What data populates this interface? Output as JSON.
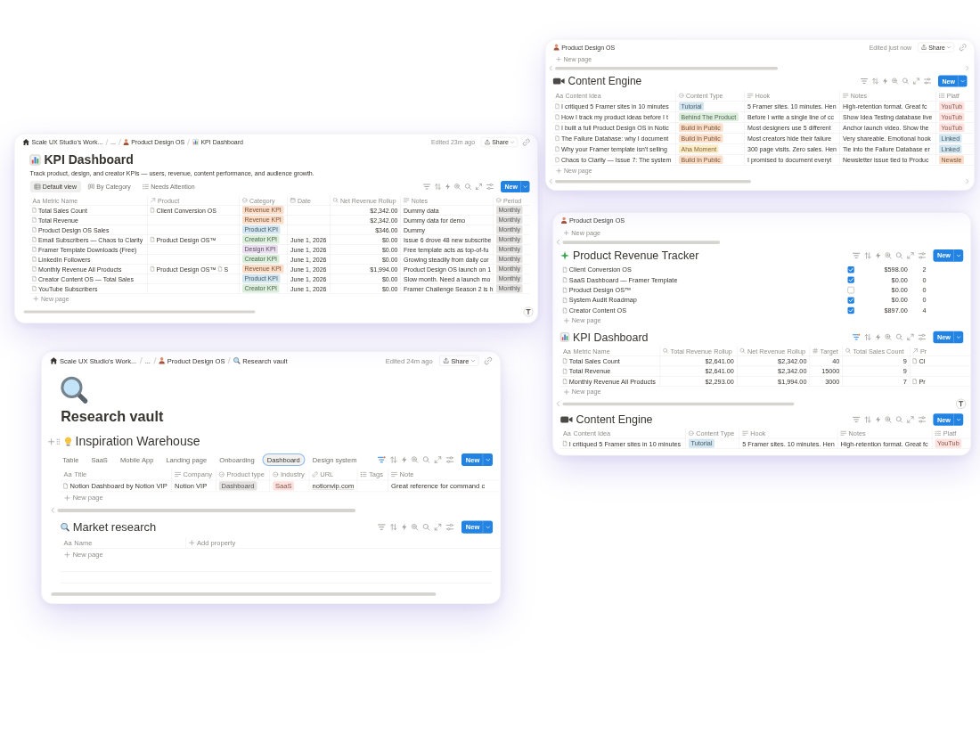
{
  "kpi_dashboard_window": {
    "breadcrumbs": [
      {
        "label": "Scale UX Studio's Work...",
        "kind": "workspace"
      },
      {
        "label": "...",
        "kind": "collapsed"
      },
      {
        "label": "Product Design OS",
        "kind": "teamspace"
      },
      {
        "label": "KPI Dashboard",
        "kind": "page"
      }
    ],
    "edited": "Edited 23m ago",
    "share": "Share",
    "title": "KPI Dashboard",
    "description": "Track product, design, and creator KPIs — users, revenue, content performance, and audience growth.",
    "views": [
      {
        "label": "Default view",
        "kind": "table",
        "selected": true
      },
      {
        "label": "By Category",
        "kind": "board",
        "selected": false
      },
      {
        "label": "Needs Attention",
        "kind": "list",
        "selected": false
      }
    ],
    "toolbar": {
      "filter_active": false,
      "new_button": "New"
    },
    "table": {
      "columns": [
        {
          "glyph": "Aa",
          "label": "Metric Name",
          "kind": "title"
        },
        {
          "label": "Product",
          "kind": "relation"
        },
        {
          "label": "Category",
          "kind": "select"
        },
        {
          "label": "Date",
          "kind": "date"
        },
        {
          "label": "Net Revenue Rollup",
          "kind": "rollup"
        },
        {
          "label": "Notes",
          "kind": "text"
        },
        {
          "label": "Period",
          "kind": "select"
        }
      ],
      "rows": [
        [
          "Total Sales Count",
          [
            "Client Conversion OS"
          ],
          {
            "label": "Revenue KPI",
            "color": "#fadec9"
          },
          null,
          "$2,342.00",
          "Dummy data",
          {
            "label": "Monthly",
            "color": "#e3e2e0"
          }
        ],
        [
          "Total Revenue",
          null,
          {
            "label": "Revenue KPI",
            "color": "#fadec9"
          },
          null,
          "$2,342.00",
          "Dummy data for demo",
          {
            "label": "Monthly",
            "color": "#e3e2e0"
          }
        ],
        [
          "Product Design OS Sales",
          null,
          {
            "label": "Product KPI",
            "color": "#d3e5ef"
          },
          null,
          "$346.00",
          "Dummy",
          {
            "label": "Monthly",
            "color": "#e3e2e0"
          }
        ],
        [
          "Email Subscribers — Chaos to Clarity",
          [
            "Product Design OS™"
          ],
          {
            "label": "Creator KPI",
            "color": "#dbeddb"
          },
          "June 1, 2026",
          "$0.00",
          "Issue 6 drove 48 new subscribe",
          {
            "label": "Monthly",
            "color": "#e3e2e0"
          }
        ],
        [
          "Framer Template Downloads (Free)",
          null,
          {
            "label": "Design KPI",
            "color": "#e8deee"
          },
          "June 1, 2026",
          "$0.00",
          "Free template acts as top-of-fu",
          {
            "label": "Monthly",
            "color": "#e3e2e0"
          }
        ],
        [
          "LinkedIn Followers",
          null,
          {
            "label": "Creator KPI",
            "color": "#dbeddb"
          },
          "June 1, 2026",
          "$0.00",
          "Growing steadily from daily cor",
          {
            "label": "Monthly",
            "color": "#e3e2e0"
          }
        ],
        [
          "Monthly Revenue All Products",
          [
            "Product Design OS™",
            "S"
          ],
          {
            "label": "Revenue KPI",
            "color": "#fadec9"
          },
          "June 1, 2026",
          "$1,994.00",
          "Product Design OS launch on 1",
          {
            "label": "Monthly",
            "color": "#e3e2e0"
          }
        ],
        [
          "Creator Content OS — Total Sales",
          null,
          {
            "label": "Product KPI",
            "color": "#d3e5ef"
          },
          "June 1, 2026",
          "$0.00",
          "Slow month. Need a launch mo",
          {
            "label": "Monthly",
            "color": "#e3e2e0"
          }
        ],
        [
          "YouTube Subscribers",
          null,
          {
            "label": "Creator KPI",
            "color": "#dbeddb"
          },
          "June 1, 2026",
          "$0.00",
          "Framer Challenge Season 2 is h",
          {
            "label": "Monthly",
            "color": "#e3e2e0"
          }
        ]
      ],
      "new_row": "New page"
    }
  },
  "content_engine_window": {
    "breadcrumbs": [
      {
        "label": "Product Design OS",
        "kind": "teamspace"
      }
    ],
    "edited": "Edited just now",
    "share": "Share",
    "new_page_above": "New page",
    "database": {
      "title": "Content Engine",
      "toolbar": {
        "filter_active": false,
        "new_button": "New"
      },
      "table": {
        "columns": [
          {
            "glyph": "Aa",
            "label": "Content Idea",
            "kind": "title"
          },
          {
            "label": "Content Type",
            "kind": "select"
          },
          {
            "label": "Hook",
            "kind": "text"
          },
          {
            "label": "Notes",
            "kind": "text"
          },
          {
            "label": "Platf",
            "kind": "multi_select"
          }
        ],
        "rows": [
          [
            "I critiqued 5 Framer sites in 10 minutes",
            {
              "label": "Tutorial",
              "color": "#d3e5ef"
            },
            "5 Framer sites. 10 minutes. Hen",
            "High-retention format. Great fc",
            [
              {
                "label": "YouTub",
                "color": "#ffe2dd"
              }
            ]
          ],
          [
            "How I track my product ideas before I t",
            {
              "label": "Behind The Product",
              "color": "#dbeddb"
            },
            "Before I write a single line of cc",
            "Show Idea Testing database live",
            [
              {
                "label": "YouTub",
                "color": "#ffe2dd"
              }
            ]
          ],
          [
            "I built a full Product Design OS in Notic",
            {
              "label": "Build In Public",
              "color": "#fadec9"
            },
            "Most designers use 5 different",
            "Anchor launch video. Show the",
            [
              {
                "label": "YouTub",
                "color": "#ffe2dd"
              }
            ]
          ],
          [
            "The Failure Database: why I document",
            {
              "label": "Build In Public",
              "color": "#fadec9"
            },
            "Most creators hide their failure",
            "Very shareable. Emotional hook",
            [
              {
                "label": "Linked",
                "color": "#d3e5ef"
              }
            ]
          ],
          [
            "Why your Framer template isn't selling",
            {
              "label": "Aha Moment",
              "color": "#fdecc8"
            },
            "300 page visits. Zero sales. Hen",
            "Tie into the Failure Database er",
            [
              {
                "label": "Linked",
                "color": "#d3e5ef"
              }
            ]
          ],
          [
            "Chaos to Clarity — Issue 7: The system",
            {
              "label": "Build In Public",
              "color": "#fadec9"
            },
            "I promised to document everyt",
            "Newsletter issue tied to Produc",
            [
              {
                "label": "Newsle",
                "color": "#fadec9"
              }
            ]
          ]
        ],
        "new_row": "New page"
      }
    }
  },
  "product_window": {
    "breadcrumbs": [
      {
        "label": "Product Design OS",
        "kind": "teamspace"
      }
    ],
    "new_page_above": "New page",
    "databases": [
      {
        "title": "Product Revenue Tracker",
        "toolbar": {
          "filter_active": false,
          "new_button": "New"
        },
        "table": {
          "columns": [
            {
              "kind": "title"
            },
            {
              "kind": "checkbox"
            },
            {
              "kind": "rollup"
            },
            {
              "kind": "number"
            }
          ],
          "rows": [
            [
              "Client Conversion OS",
              {
                "checked": true
              },
              "$598.00",
              "2"
            ],
            [
              "SaaS Dashboard — Framer Template",
              {
                "checked": true
              },
              "$0.00",
              "0"
            ],
            [
              "Product Design OS™",
              {
                "checked": false
              },
              "$0.00",
              "0"
            ],
            [
              "System Audit Roadmap",
              {
                "checked": true
              },
              "$0.00",
              "0"
            ],
            [
              "Creator Content OS",
              {
                "checked": true
              },
              "$897.00",
              "4"
            ]
          ],
          "new_row": "New page"
        }
      },
      {
        "title": "KPI Dashboard",
        "toolbar": {
          "filter_active": true,
          "new_button": "New"
        },
        "table": {
          "columns": [
            {
              "glyph": "Aa",
              "label": "Metric Name",
              "kind": "title"
            },
            {
              "label": "Total Revenue Rollup",
              "kind": "rollup"
            },
            {
              "label": "Net Revenue Rollup",
              "kind": "rollup"
            },
            {
              "label": "Target",
              "kind": "number"
            },
            {
              "label": "Total Sales Count",
              "kind": "rollup"
            },
            {
              "label": "Pr",
              "kind": "relation"
            }
          ],
          "rows": [
            [
              "Total Sales Count",
              "$2,641.00",
              "$2,342.00",
              "40",
              "9",
              [
                "Cl"
              ]
            ],
            [
              "Total Revenue",
              "$2,641.00",
              "$2,342.00",
              "15000",
              "9",
              null
            ],
            [
              "Monthly Revenue All Products",
              "$2,293.00",
              "$1,994.00",
              "3000",
              "7",
              [
                "Pr"
              ]
            ]
          ],
          "new_row": "New page"
        }
      },
      {
        "title": "Content Engine",
        "toolbar": {
          "filter_active": false,
          "new_button": "New"
        },
        "table": {
          "columns": [
            {
              "glyph": "Aa",
              "label": "Content Idea",
              "kind": "title"
            },
            {
              "label": "Content Type",
              "kind": "select"
            },
            {
              "label": "Hook",
              "kind": "text"
            },
            {
              "label": "Notes",
              "kind": "text"
            },
            {
              "label": "Platf",
              "kind": "multi_select"
            }
          ],
          "rows": [
            [
              "I critiqued 5 Framer sites in 10 minutes",
              {
                "label": "Tutorial",
                "color": "#d3e5ef"
              },
              "5 Framer sites. 10 minutes. Hen",
              "High-retention format. Great fc",
              [
                {
                  "label": "YouTub",
                  "color": "#ffe2dd"
                }
              ]
            ]
          ]
        }
      }
    ]
  },
  "research_vault_window": {
    "breadcrumbs": [
      {
        "label": "Scale UX Studio's Work...",
        "kind": "workspace"
      },
      {
        "label": "...",
        "kind": "collapsed"
      },
      {
        "label": "Product Design OS",
        "kind": "teamspace"
      },
      {
        "label": "Research vault",
        "kind": "page"
      }
    ],
    "edited": "Edited 24m ago",
    "share": "Share",
    "title": "Research vault",
    "databases": [
      {
        "title": "Inspiration Warehouse",
        "views": [
          {
            "label": "Table",
            "selected": false
          },
          {
            "label": "SaaS",
            "selected": false
          },
          {
            "label": "Mobile App",
            "selected": false
          },
          {
            "label": "Landing page",
            "selected": false
          },
          {
            "label": "Onboarding",
            "selected": false
          },
          {
            "label": "Dashboard",
            "selected": true
          },
          {
            "label": "Design system",
            "selected": false
          }
        ],
        "toolbar": {
          "filter_active": true,
          "new_button": "New"
        },
        "table": {
          "columns": [
            {
              "glyph": "Aa",
              "label": "Title",
              "kind": "title"
            },
            {
              "label": "Company",
              "kind": "text"
            },
            {
              "label": "Product type",
              "kind": "select"
            },
            {
              "label": "Industry",
              "kind": "select"
            },
            {
              "label": "URL",
              "kind": "url"
            },
            {
              "label": "Tags",
              "kind": "multi_select"
            },
            {
              "label": "Note",
              "kind": "text"
            }
          ],
          "rows": [
            [
              "Notion Dashboard by Notion VIP",
              "Notion VIP",
              {
                "label": "Dashboard",
                "color": "#e3e2e0"
              },
              {
                "label": "SaaS",
                "color": "#ffe2dd"
              },
              "notionvip.com",
              null,
              "Great reference for command c"
            ]
          ],
          "new_row": "New page"
        }
      },
      {
        "title": "Market research",
        "toolbar": {
          "filter_active": false,
          "new_button": "New"
        },
        "table": {
          "columns": [
            {
              "glyph": "Aa",
              "label": "Name",
              "kind": "title"
            },
            {
              "label": "Add property",
              "kind": "add"
            }
          ],
          "new_row": "New page"
        }
      }
    ]
  }
}
